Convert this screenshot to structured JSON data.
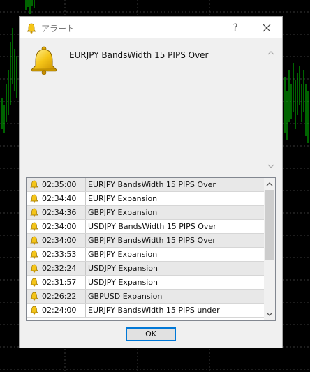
{
  "window": {
    "title": "アラート",
    "help_label": "?"
  },
  "message": {
    "text": "EURJPY BandsWidth 15 PIPS Over"
  },
  "alerts": [
    {
      "time": "02:35:00",
      "message": "EURJPY BandsWidth 15 PIPS Over"
    },
    {
      "time": "02:34:40",
      "message": "EURJPY Expansion"
    },
    {
      "time": "02:34:36",
      "message": "GBPJPY Expansion"
    },
    {
      "time": "02:34:00",
      "message": "USDJPY BandsWidth 15 PIPS Over"
    },
    {
      "time": "02:34:00",
      "message": "GBPJPY BandsWidth 15 PIPS Over"
    },
    {
      "time": "02:33:53",
      "message": "GBPJPY Expansion"
    },
    {
      "time": "02:32:24",
      "message": "USDJPY Expansion"
    },
    {
      "time": "02:31:57",
      "message": "USDJPY Expansion"
    },
    {
      "time": "02:26:22",
      "message": "GBPUSD Expansion"
    },
    {
      "time": "02:24:00",
      "message": "EURJPY BandsWidth 15 PIPS under"
    }
  ],
  "buttons": {
    "ok_label": "OK"
  },
  "colors": {
    "chart_background": "#000000",
    "chart_candles": "#00c800",
    "chart_grid": "#3a3a3a",
    "bell_gold": "#f5c518",
    "ok_border": "#0078d7"
  },
  "icons": {
    "title": "bell-icon",
    "message": "bell-icon",
    "row": "bell-icon",
    "close": "close-icon"
  }
}
